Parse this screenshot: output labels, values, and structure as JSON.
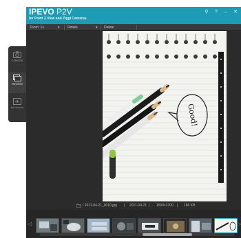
{
  "app": {
    "brand_bold": "IPEVO",
    "brand_light": "P2V",
    "subtitle": "for Point 2 View and Ziggi Cameras"
  },
  "window_controls": {
    "settings": "⚲",
    "help": "?",
    "minimize": "–",
    "close": "✕"
  },
  "toolbar": {
    "zoom_label": "Zoom: 1x",
    "zoom_arrow": "▾",
    "rotate_label": "Rotate",
    "rotate_arrow": "▾",
    "delete_label": "Delete"
  },
  "dock": {
    "items": [
      {
        "label": "CAMERA",
        "icon": "camera-icon",
        "active": false
      },
      {
        "label": "REVIEW",
        "icon": "review-icon",
        "active": true
      },
      {
        "label": "full screen",
        "icon": "fullscreen-icon",
        "active": false
      }
    ]
  },
  "viewer": {
    "speech_text": "Good!"
  },
  "info": {
    "filename": "/ 2011-04-21_0010.jpg",
    "date": "2011-04-21",
    "resolution": "1600x1200",
    "filesize": "186 KB"
  },
  "filmstrip": {
    "left_arrow": "◁",
    "right_arrow": "▷",
    "selected_index": 7,
    "scroll_position": 0.71
  },
  "colors": {
    "accent": "#1e9bb5",
    "background": "#2b2b2b"
  }
}
